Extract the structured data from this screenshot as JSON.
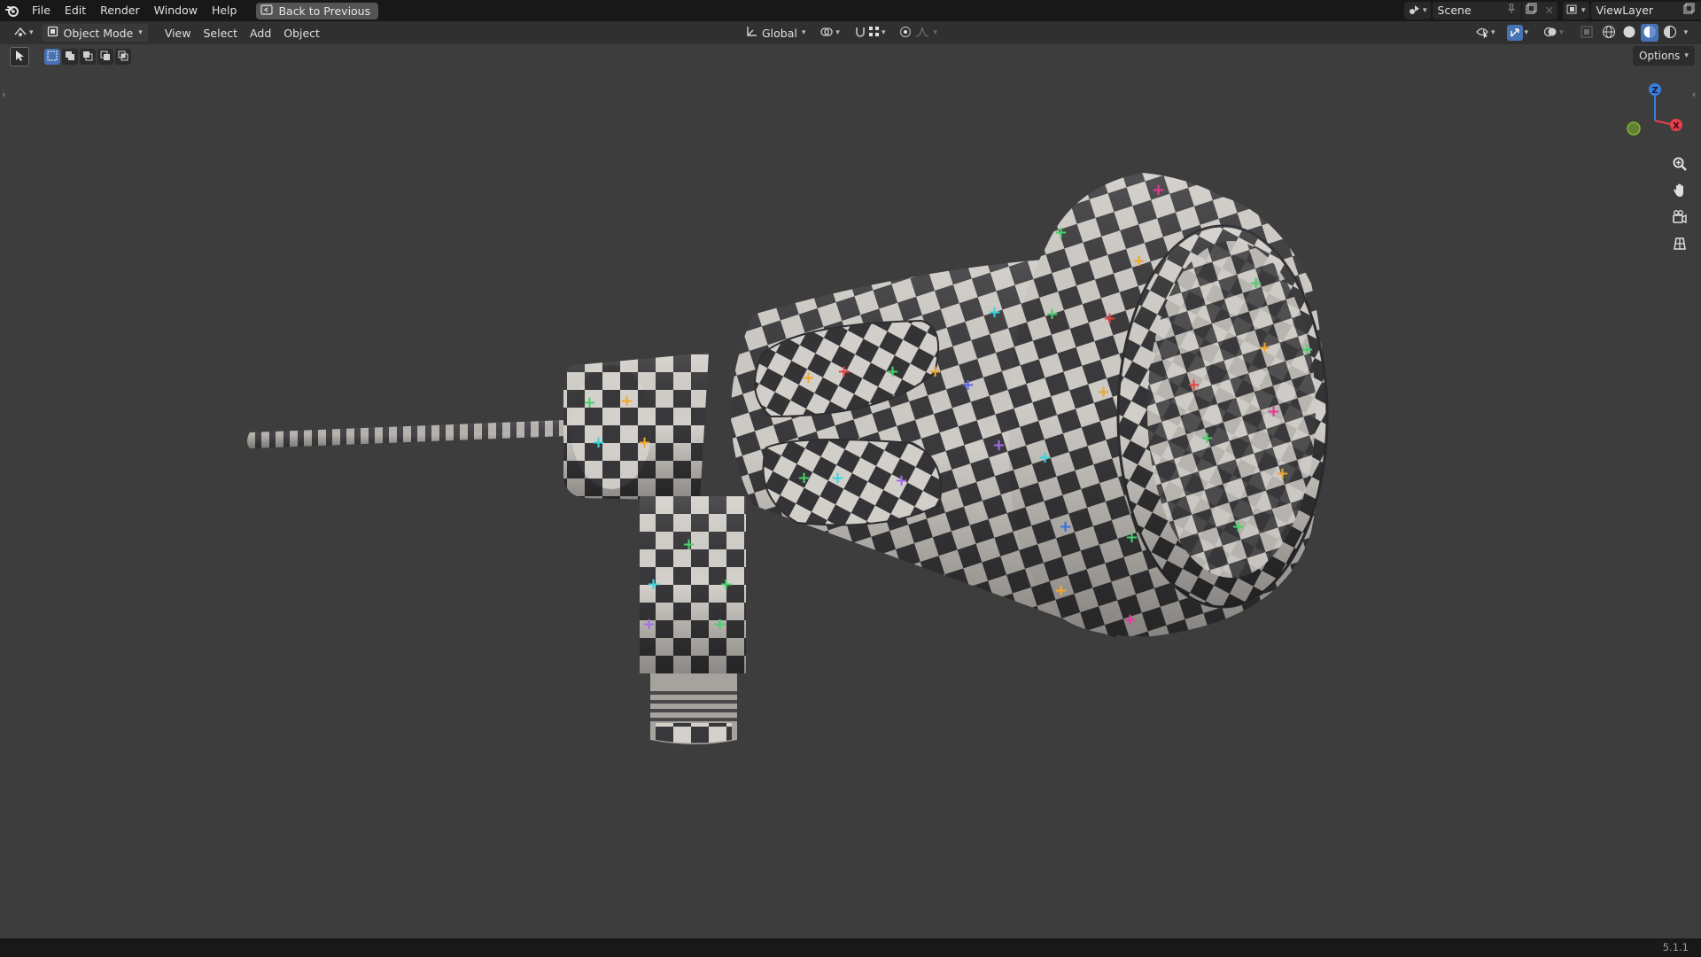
{
  "topbar": {
    "menu": [
      "File",
      "Edit",
      "Render",
      "Window",
      "Help"
    ],
    "back_label": "Back to Previous",
    "scene": "Scene",
    "view_layer": "ViewLayer"
  },
  "header": {
    "mode": "Object Mode",
    "menus": [
      "View",
      "Select",
      "Add",
      "Object"
    ],
    "transform_orientation": "Global"
  },
  "viewport": {
    "options_label": "Options",
    "gizmo": {
      "z": "Z",
      "x": "X"
    }
  },
  "icons": {
    "app": "blender-logo-icon",
    "zoom": "zoom-icon",
    "pan": "hand-icon",
    "camera": "camera-icon",
    "ortho": "grid-icon"
  },
  "colors": {
    "axis_x": "#e8404b",
    "axis_y": "#82b92f",
    "axis_z": "#3a7de0"
  },
  "status": {
    "version": "5.1.1"
  }
}
